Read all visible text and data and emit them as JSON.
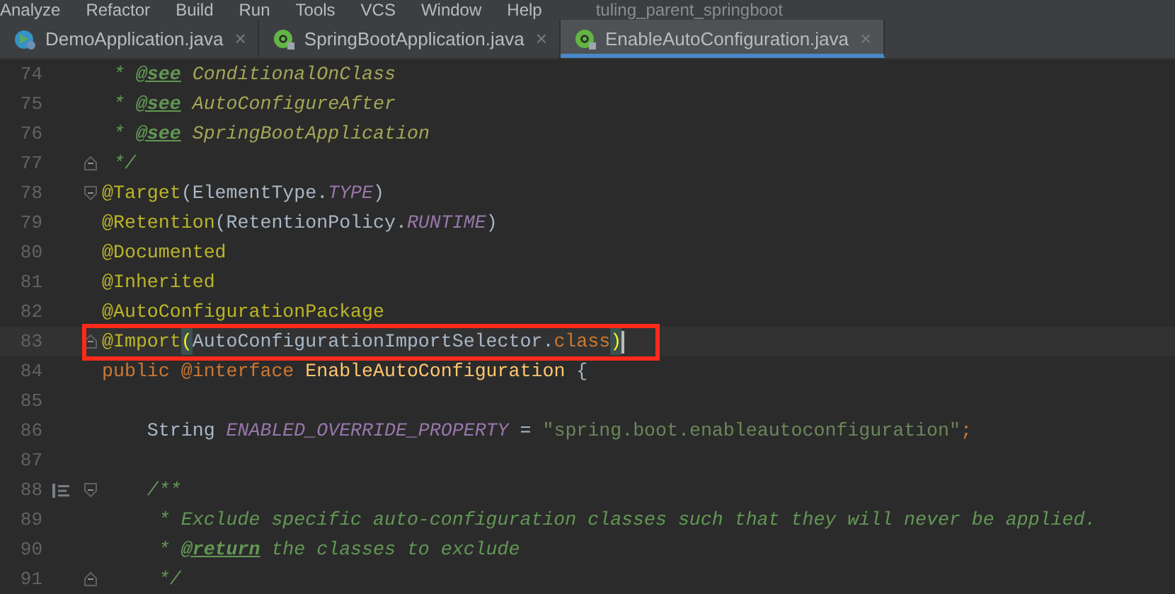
{
  "menu_bar": {
    "items": [
      "Analyze",
      "Refactor",
      "Build",
      "Run",
      "Tools",
      "VCS",
      "Window",
      "Help"
    ],
    "project_title": "tuling_parent_springboot"
  },
  "tabs": [
    {
      "label": "DemoApplication.java",
      "kind": "run-class",
      "selected": false,
      "close": "×"
    },
    {
      "label": "SpringBootApplication.java",
      "kind": "annotation",
      "selected": false,
      "close": "×"
    },
    {
      "label": "EnableAutoConfiguration.java",
      "kind": "annotation",
      "selected": true,
      "close": "×"
    }
  ],
  "editor": {
    "lines": [
      {
        "number": "74",
        "tokens": [
          {
            "kind": "comment",
            "text": " * "
          },
          {
            "kind": "doctag",
            "text": "@see"
          },
          {
            "kind": "docref",
            "text": " ConditionalOnClass"
          }
        ]
      },
      {
        "number": "75",
        "tokens": [
          {
            "kind": "comment",
            "text": " * "
          },
          {
            "kind": "doctag",
            "text": "@see"
          },
          {
            "kind": "docref",
            "text": " AutoConfigureAfter"
          }
        ]
      },
      {
        "number": "76",
        "tokens": [
          {
            "kind": "comment",
            "text": " * "
          },
          {
            "kind": "doctag",
            "text": "@see"
          },
          {
            "kind": "docref",
            "text": " SpringBootApplication"
          }
        ]
      },
      {
        "number": "77",
        "fold_end": true,
        "tokens": [
          {
            "kind": "comment",
            "text": " */"
          }
        ]
      },
      {
        "number": "78",
        "fold_start": true,
        "tokens": [
          {
            "kind": "annotation",
            "text": "@Target"
          },
          {
            "kind": "plain",
            "text": "(ElementType."
          },
          {
            "kind": "constant",
            "text": "TYPE"
          },
          {
            "kind": "plain",
            "text": ")"
          }
        ]
      },
      {
        "number": "79",
        "tokens": [
          {
            "kind": "annotation",
            "text": "@Retention"
          },
          {
            "kind": "plain",
            "text": "(RetentionPolicy."
          },
          {
            "kind": "constant",
            "text": "RUNTIME"
          },
          {
            "kind": "plain",
            "text": ")"
          }
        ]
      },
      {
        "number": "80",
        "tokens": [
          {
            "kind": "annotation",
            "text": "@Documented"
          }
        ]
      },
      {
        "number": "81",
        "tokens": [
          {
            "kind": "annotation",
            "text": "@Inherited"
          }
        ]
      },
      {
        "number": "82",
        "tokens": [
          {
            "kind": "annotation",
            "text": "@AutoConfigurationPackage"
          }
        ]
      },
      {
        "number": "83",
        "fold_end": true,
        "selected": true,
        "boxed": true,
        "tokens": [
          {
            "kind": "annotation",
            "text": "@Import"
          },
          {
            "kind": "bracket",
            "text": "("
          },
          {
            "kind": "plain",
            "text": "AutoConfigurationImportSelector."
          },
          {
            "kind": "keyword",
            "text": "class"
          },
          {
            "kind": "bracket",
            "text": ")"
          }
        ]
      },
      {
        "number": "84",
        "tokens": [
          {
            "kind": "keyword",
            "text": "public @interface "
          },
          {
            "kind": "declaration",
            "text": "EnableAutoConfiguration"
          },
          {
            "kind": "plain",
            "text": " {"
          }
        ]
      },
      {
        "number": "85"
      },
      {
        "number": "86",
        "tokens": [
          {
            "kind": "plain",
            "text": "    String "
          },
          {
            "kind": "constant",
            "text": "ENABLED_OVERRIDE_PROPERTY"
          },
          {
            "kind": "plain",
            "text": " = "
          },
          {
            "kind": "string",
            "text": "\"spring.boot.enableautoconfiguration\""
          },
          {
            "kind": "keyword",
            "text": ";"
          }
        ]
      },
      {
        "number": "87"
      },
      {
        "number": "88",
        "fold_start": true,
        "doc_toggle": true,
        "tokens": [
          {
            "kind": "comment",
            "text": "    /**"
          }
        ]
      },
      {
        "number": "89",
        "tokens": [
          {
            "kind": "comment",
            "text": "     * Exclude specific auto-configuration classes such that they will never be applied."
          }
        ]
      },
      {
        "number": "90",
        "tokens": [
          {
            "kind": "comment",
            "text": "     * "
          },
          {
            "kind": "doctag",
            "text": "@return"
          },
          {
            "kind": "comment",
            "text": " the classes to exclude"
          }
        ]
      },
      {
        "number": "91",
        "fold_end": true,
        "tokens": [
          {
            "kind": "comment",
            "text": "     */"
          }
        ]
      }
    ]
  }
}
